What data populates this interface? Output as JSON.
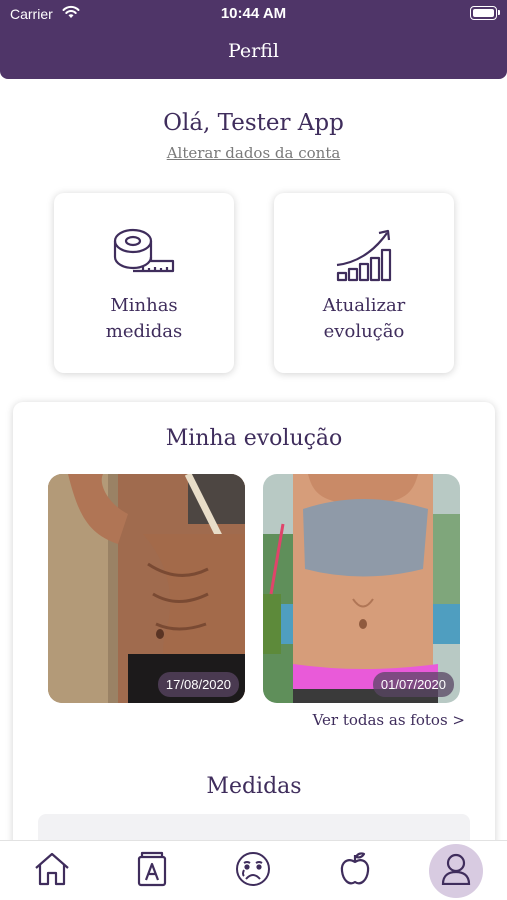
{
  "status_bar": {
    "carrier": "Carrier",
    "time": "10:44 AM"
  },
  "header": {
    "title": "Perfil"
  },
  "profile": {
    "greeting": "Olá, Tester App",
    "edit_account_link": "Alterar dados da conta"
  },
  "actions": [
    {
      "label": "Minhas medidas",
      "icon": "measuring-tape-icon"
    },
    {
      "label": "Atualizar evolução",
      "icon": "growth-chart-icon"
    }
  ],
  "evolution": {
    "title": "Minha evolução",
    "photos": [
      {
        "date": "17/08/2020"
      },
      {
        "date": "01/07/2020"
      }
    ],
    "see_all": "Ver todas as fotos >"
  },
  "measures": {
    "title": "Medidas"
  },
  "tabbar": {
    "items": [
      "home-icon",
      "book-icon",
      "sad-face-icon",
      "apple-icon",
      "profile-icon"
    ],
    "active": "profile-icon"
  },
  "colors": {
    "primary": "#4f3568",
    "text": "#3f2d5c",
    "active_tab_bg": "#d8cbe1"
  }
}
